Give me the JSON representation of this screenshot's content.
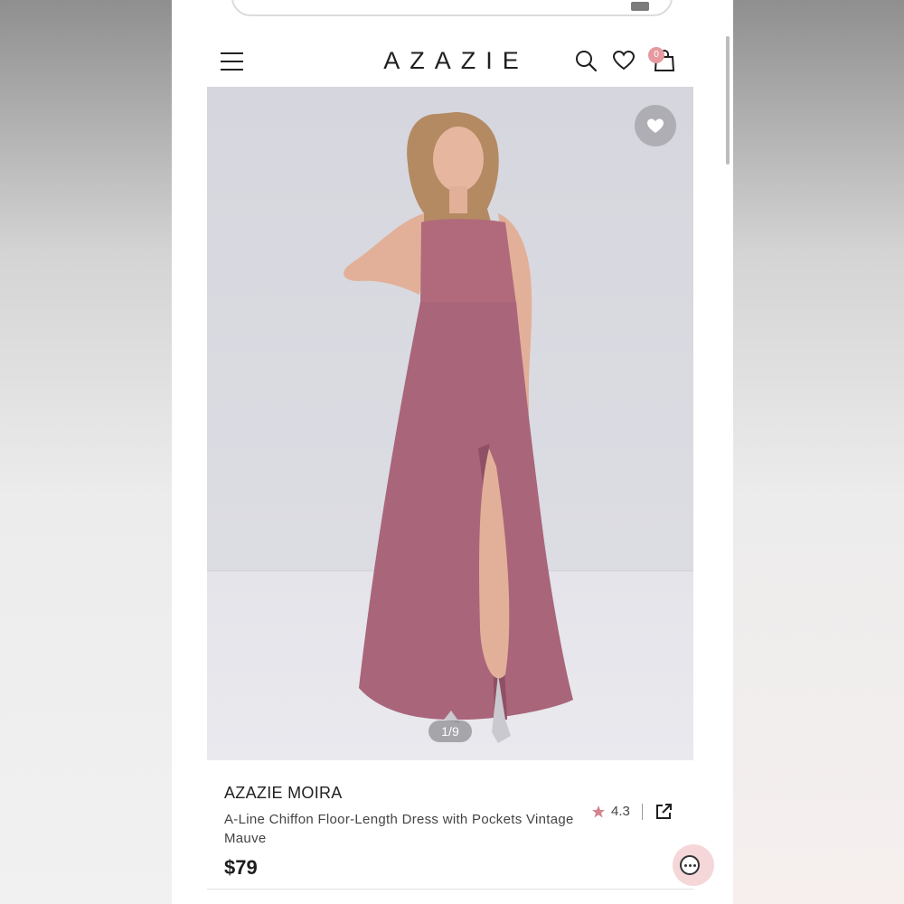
{
  "header": {
    "brand": "AZAZIE",
    "bag_count": "0",
    "icons": [
      "hamburger-menu-icon",
      "search-icon",
      "heart-icon",
      "shopping-bag-icon"
    ]
  },
  "gallery": {
    "counter": "1/9",
    "favorite_icon": "heart-icon"
  },
  "product": {
    "brand_name": "AZAZIE MOIRA",
    "title": "A-Line Chiffon Floor-Length Dress with Pockets Vintage Mauve",
    "price": "$79",
    "rating": "4.3",
    "share_icon": "share-external-icon"
  },
  "colors": {
    "accent": "#e69aa0",
    "dress": "#b06a7c",
    "star": "#d2858f"
  },
  "chat": {
    "icon": "chat-icon"
  }
}
